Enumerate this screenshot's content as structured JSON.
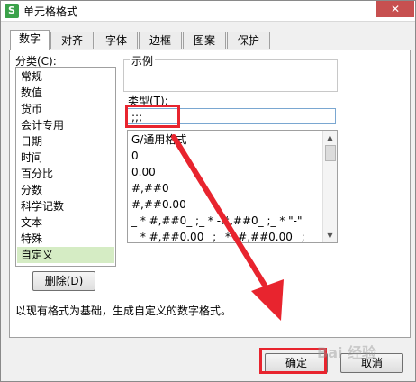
{
  "window": {
    "title": "单元格格式",
    "app_icon_letter": "S",
    "close_glyph": "✕"
  },
  "tabs": [
    {
      "label": "数字",
      "active": true
    },
    {
      "label": "对齐"
    },
    {
      "label": "字体"
    },
    {
      "label": "边框"
    },
    {
      "label": "图案"
    },
    {
      "label": "保护"
    }
  ],
  "category": {
    "label": "分类(C):",
    "items": [
      "常规",
      "数值",
      "货币",
      "会计专用",
      "日期",
      "时间",
      "百分比",
      "分数",
      "科学记数",
      "文本",
      "特殊",
      "自定义"
    ],
    "selected": "自定义"
  },
  "sample": {
    "label": "示例"
  },
  "type": {
    "label": "类型(T):",
    "value": ";;;",
    "formats": [
      "G/通用格式",
      "0",
      "0.00",
      "#,##0",
      "#,##0.00",
      "_ * #,##0_ ;_ * -#,##0_ ;_ * \"-\"",
      "_ * #,##0.00_ ;_ * -#,##0.00_ ;_"
    ]
  },
  "delete_button": "删除(D)",
  "hint": "以现有格式为基础，生成自定义的数字格式。",
  "ok_button": "确定",
  "cancel_button": "取消",
  "watermark": "Bai 经验",
  "colors": {
    "highlight": "#e8242e",
    "selected_row": "#d5ecc4",
    "app_icon": "#3ba24a"
  }
}
